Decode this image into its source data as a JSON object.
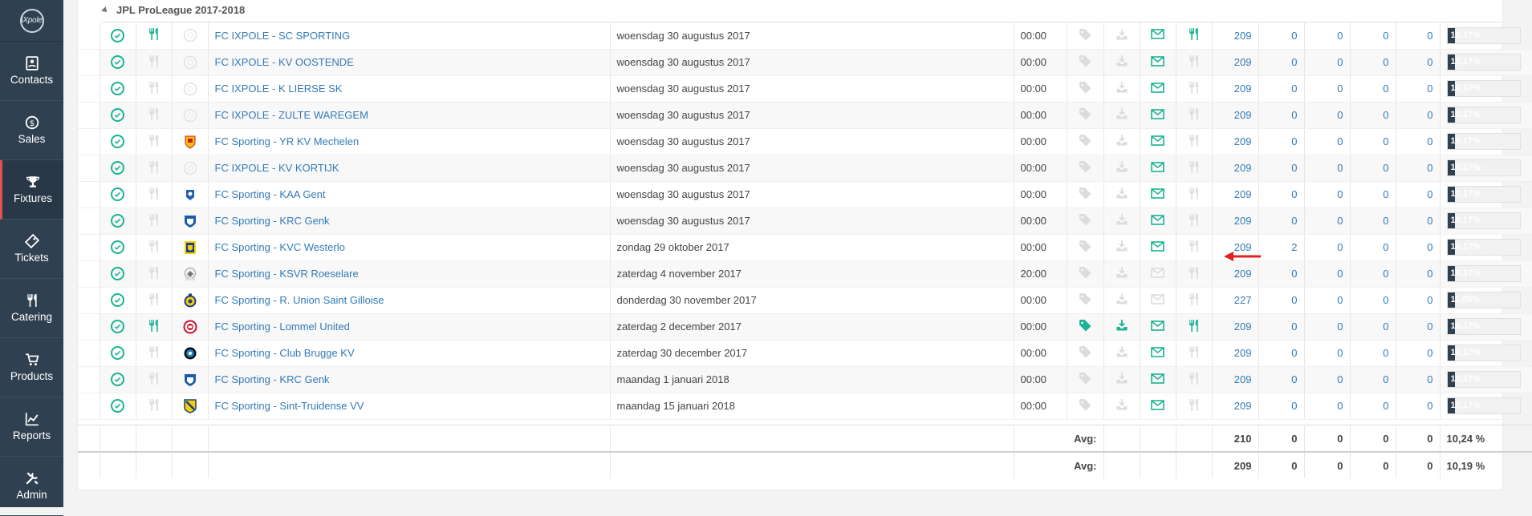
{
  "app": {
    "logo_text": "iXpole"
  },
  "sidebar": {
    "items": [
      {
        "label": "Contacts",
        "icon": "contacts-icon"
      },
      {
        "label": "Sales",
        "icon": "sales-icon"
      },
      {
        "label": "Fixtures",
        "icon": "trophy-icon",
        "active": true
      },
      {
        "label": "Tickets",
        "icon": "tickets-icon"
      },
      {
        "label": "Catering",
        "icon": "catering-icon"
      },
      {
        "label": "Products",
        "icon": "cart-icon"
      },
      {
        "label": "Reports",
        "icon": "reports-icon"
      },
      {
        "label": "Admin",
        "icon": "admin-icon"
      }
    ]
  },
  "group": {
    "title": "JPL ProLeague 2017-2018"
  },
  "fixtures": [
    {
      "name": "FC IXPOLE - SC SPORTING",
      "date": "woensdag 30 augustus 2017",
      "time": "00:00",
      "catering": true,
      "tag": false,
      "download": false,
      "mail": true,
      "catering2": true,
      "v1": "209",
      "v2": "0",
      "v3": "0",
      "v4": "0",
      "v5": "0",
      "pct_label": "10,17%",
      "pct": 0.1017,
      "club": "ixpole"
    },
    {
      "name": "FC IXPOLE - KV OOSTENDE",
      "date": "woensdag 30 augustus 2017",
      "time": "00:00",
      "catering": false,
      "tag": false,
      "download": false,
      "mail": true,
      "catering2": false,
      "v1": "209",
      "v2": "0",
      "v3": "0",
      "v4": "0",
      "v5": "0",
      "pct_label": "10,17%",
      "pct": 0.1017,
      "club": "ixpole"
    },
    {
      "name": "FC IXPOLE - K LIERSE SK",
      "date": "woensdag 30 augustus 2017",
      "time": "00:00",
      "catering": false,
      "tag": false,
      "download": false,
      "mail": true,
      "catering2": false,
      "v1": "209",
      "v2": "0",
      "v3": "0",
      "v4": "0",
      "v5": "0",
      "pct_label": "10,17%",
      "pct": 0.1017,
      "club": "ixpole"
    },
    {
      "name": "FC IXPOLE - ZULTE WAREGEM",
      "date": "woensdag 30 augustus 2017",
      "time": "00:00",
      "catering": false,
      "tag": false,
      "download": false,
      "mail": true,
      "catering2": false,
      "v1": "209",
      "v2": "0",
      "v3": "0",
      "v4": "0",
      "v5": "0",
      "pct_label": "10,17%",
      "pct": 0.1017,
      "club": "ixpole"
    },
    {
      "name": "FC Sporting - YR KV Mechelen",
      "date": "woensdag 30 augustus 2017",
      "time": "00:00",
      "catering": false,
      "tag": false,
      "download": false,
      "mail": true,
      "catering2": false,
      "v1": "209",
      "v2": "0",
      "v3": "0",
      "v4": "0",
      "v5": "0",
      "pct_label": "10,17%",
      "pct": 0.1017,
      "club": "mechelen"
    },
    {
      "name": "FC IXPOLE - KV KORTIJK",
      "date": "woensdag 30 augustus 2017",
      "time": "00:00",
      "catering": false,
      "tag": false,
      "download": false,
      "mail": true,
      "catering2": false,
      "v1": "209",
      "v2": "0",
      "v3": "0",
      "v4": "0",
      "v5": "0",
      "pct_label": "10,17%",
      "pct": 0.1017,
      "club": "ixpole"
    },
    {
      "name": "FC Sporting - KAA Gent",
      "date": "woensdag 30 augustus 2017",
      "time": "00:00",
      "catering": false,
      "tag": false,
      "download": false,
      "mail": true,
      "catering2": false,
      "v1": "209",
      "v2": "0",
      "v3": "0",
      "v4": "0",
      "v5": "0",
      "pct_label": "10,17%",
      "pct": 0.1017,
      "club": "gent"
    },
    {
      "name": "FC Sporting - KRC Genk",
      "date": "woensdag 30 augustus 2017",
      "time": "00:00",
      "catering": false,
      "tag": false,
      "download": false,
      "mail": true,
      "catering2": false,
      "v1": "209",
      "v2": "0",
      "v3": "0",
      "v4": "0",
      "v5": "0",
      "pct_label": "10,17%",
      "pct": 0.1017,
      "club": "genk"
    },
    {
      "name": "FC Sporting - KVC Westerlo",
      "date": "zondag 29 oktober 2017",
      "time": "00:00",
      "catering": false,
      "tag": false,
      "download": false,
      "mail": true,
      "catering2": false,
      "v1": "209",
      "v2": "2",
      "v3": "0",
      "v4": "0",
      "v5": "0",
      "pct_label": "10,17%",
      "pct": 0.1017,
      "club": "westerlo"
    },
    {
      "name": "FC Sporting - KSVR Roeselare",
      "date": "zaterdag 4 november 2017",
      "time": "20:00",
      "catering": false,
      "tag": false,
      "download": false,
      "mail": false,
      "catering2": false,
      "v1": "209",
      "v2": "0",
      "v3": "0",
      "v4": "0",
      "v5": "0",
      "pct_label": "10,17%",
      "pct": 0.1017,
      "club": "roeselare"
    },
    {
      "name": "FC Sporting - R. Union Saint Gilloise",
      "date": "donderdag 30 november 2017",
      "time": "00:00",
      "catering": false,
      "tag": false,
      "download": false,
      "mail": false,
      "catering2": false,
      "v1": "227",
      "v2": "0",
      "v3": "0",
      "v4": "0",
      "v5": "0",
      "pct_label": "11,05%",
      "pct": 0.1105,
      "club": "union"
    },
    {
      "name": "FC Sporting - Lommel United",
      "date": "zaterdag 2 december 2017",
      "time": "00:00",
      "catering": true,
      "tag": true,
      "download": true,
      "mail": true,
      "catering2": true,
      "v1": "209",
      "v2": "0",
      "v3": "0",
      "v4": "0",
      "v5": "0",
      "pct_label": "10,17%",
      "pct": 0.1017,
      "club": "lommel"
    },
    {
      "name": "FC Sporting - Club Brugge KV",
      "date": "zaterdag 30 december 2017",
      "time": "00:00",
      "catering": false,
      "tag": false,
      "download": false,
      "mail": true,
      "catering2": false,
      "v1": "209",
      "v2": "0",
      "v3": "0",
      "v4": "0",
      "v5": "0",
      "pct_label": "10,17%",
      "pct": 0.1017,
      "club": "brugge"
    },
    {
      "name": "FC Sporting - KRC Genk",
      "date": "maandag 1 januari 2018",
      "time": "00:00",
      "catering": false,
      "tag": false,
      "download": false,
      "mail": true,
      "catering2": false,
      "v1": "209",
      "v2": "0",
      "v3": "0",
      "v4": "0",
      "v5": "0",
      "pct_label": "10,17%",
      "pct": 0.1017,
      "club": "genk"
    },
    {
      "name": "FC Sporting - Sint-Truidense VV",
      "date": "maandag 15 januari 2018",
      "time": "00:00",
      "catering": false,
      "tag": false,
      "download": false,
      "mail": true,
      "catering2": false,
      "v1": "209",
      "v2": "0",
      "v3": "0",
      "v4": "0",
      "v5": "0",
      "pct_label": "10,17%",
      "pct": 0.1017,
      "club": "stvv"
    }
  ],
  "group_avg": {
    "label": "Avg:",
    "v1": "210",
    "v2": "0",
    "v3": "0",
    "v4": "0",
    "v5": "0",
    "pct": "10,24 %"
  },
  "total_avg": {
    "label": "Avg:",
    "v1": "209",
    "v2": "0",
    "v3": "0",
    "v4": "0",
    "v5": "0",
    "pct": "10,19 %"
  },
  "colors": {
    "sidebar": "#2f4050",
    "accent": "#1ab394",
    "link": "#337ab7",
    "active_marker": "#e25252",
    "arrow": "#e02020"
  }
}
